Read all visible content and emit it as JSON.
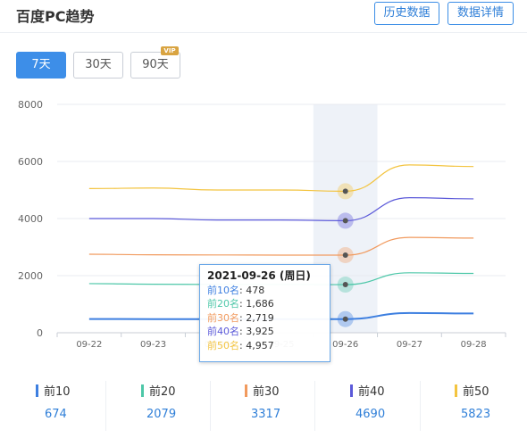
{
  "header": {
    "title": "百度PC趋势",
    "history_btn": "历史数据",
    "detail_btn": "数据详情"
  },
  "tabs": [
    {
      "label": "7天",
      "active": true
    },
    {
      "label": "30天",
      "active": false
    },
    {
      "label": "90天",
      "active": false
    }
  ],
  "vip_badge": "VIP",
  "chart_data": {
    "type": "line",
    "categories": [
      "09-22",
      "09-23",
      "09-24",
      "09-25",
      "09-26",
      "09-27",
      "09-28"
    ],
    "ylim": [
      0,
      8000
    ],
    "yticks": [
      0,
      2000,
      4000,
      6000,
      8000
    ],
    "highlight_index": 4,
    "series": [
      {
        "name": "前10名",
        "color": "#3d7fe0",
        "values": [
          480,
          478,
          478,
          478,
          478,
          690,
          674
        ]
      },
      {
        "name": "前20名",
        "color": "#4dc7a8",
        "values": [
          1720,
          1700,
          1690,
          1686,
          1686,
          2100,
          2079
        ]
      },
      {
        "name": "前30名",
        "color": "#f19a5e",
        "values": [
          2750,
          2730,
          2725,
          2719,
          2719,
          3340,
          3317
        ]
      },
      {
        "name": "前40名",
        "color": "#5b59d9",
        "values": [
          4000,
          4000,
          3950,
          3950,
          3925,
          4730,
          4690
        ]
      },
      {
        "name": "前50名",
        "color": "#f3c440",
        "values": [
          5050,
          5070,
          5000,
          5000,
          4957,
          5880,
          5823
        ]
      }
    ]
  },
  "tooltip": {
    "title": "2021-09-26 (周日)",
    "rows": [
      {
        "label": "前10名",
        "value": "478",
        "color": "#3d7fe0"
      },
      {
        "label": "前20名",
        "value": "1,686",
        "color": "#4dc7a8"
      },
      {
        "label": "前30名",
        "value": "2,719",
        "color": "#f19a5e"
      },
      {
        "label": "前40名",
        "value": "3,925",
        "color": "#5b59d9"
      },
      {
        "label": "前50名",
        "value": "4,957",
        "color": "#f3c440"
      }
    ]
  },
  "summary": [
    {
      "label": "前10",
      "value": "674",
      "color": "#3d7fe0"
    },
    {
      "label": "前20",
      "value": "2079",
      "color": "#4dc7a8"
    },
    {
      "label": "前30",
      "value": "3317",
      "color": "#f19a5e"
    },
    {
      "label": "前40",
      "value": "4690",
      "color": "#5b59d9"
    },
    {
      "label": "前50",
      "value": "5823",
      "color": "#f3c440"
    }
  ]
}
